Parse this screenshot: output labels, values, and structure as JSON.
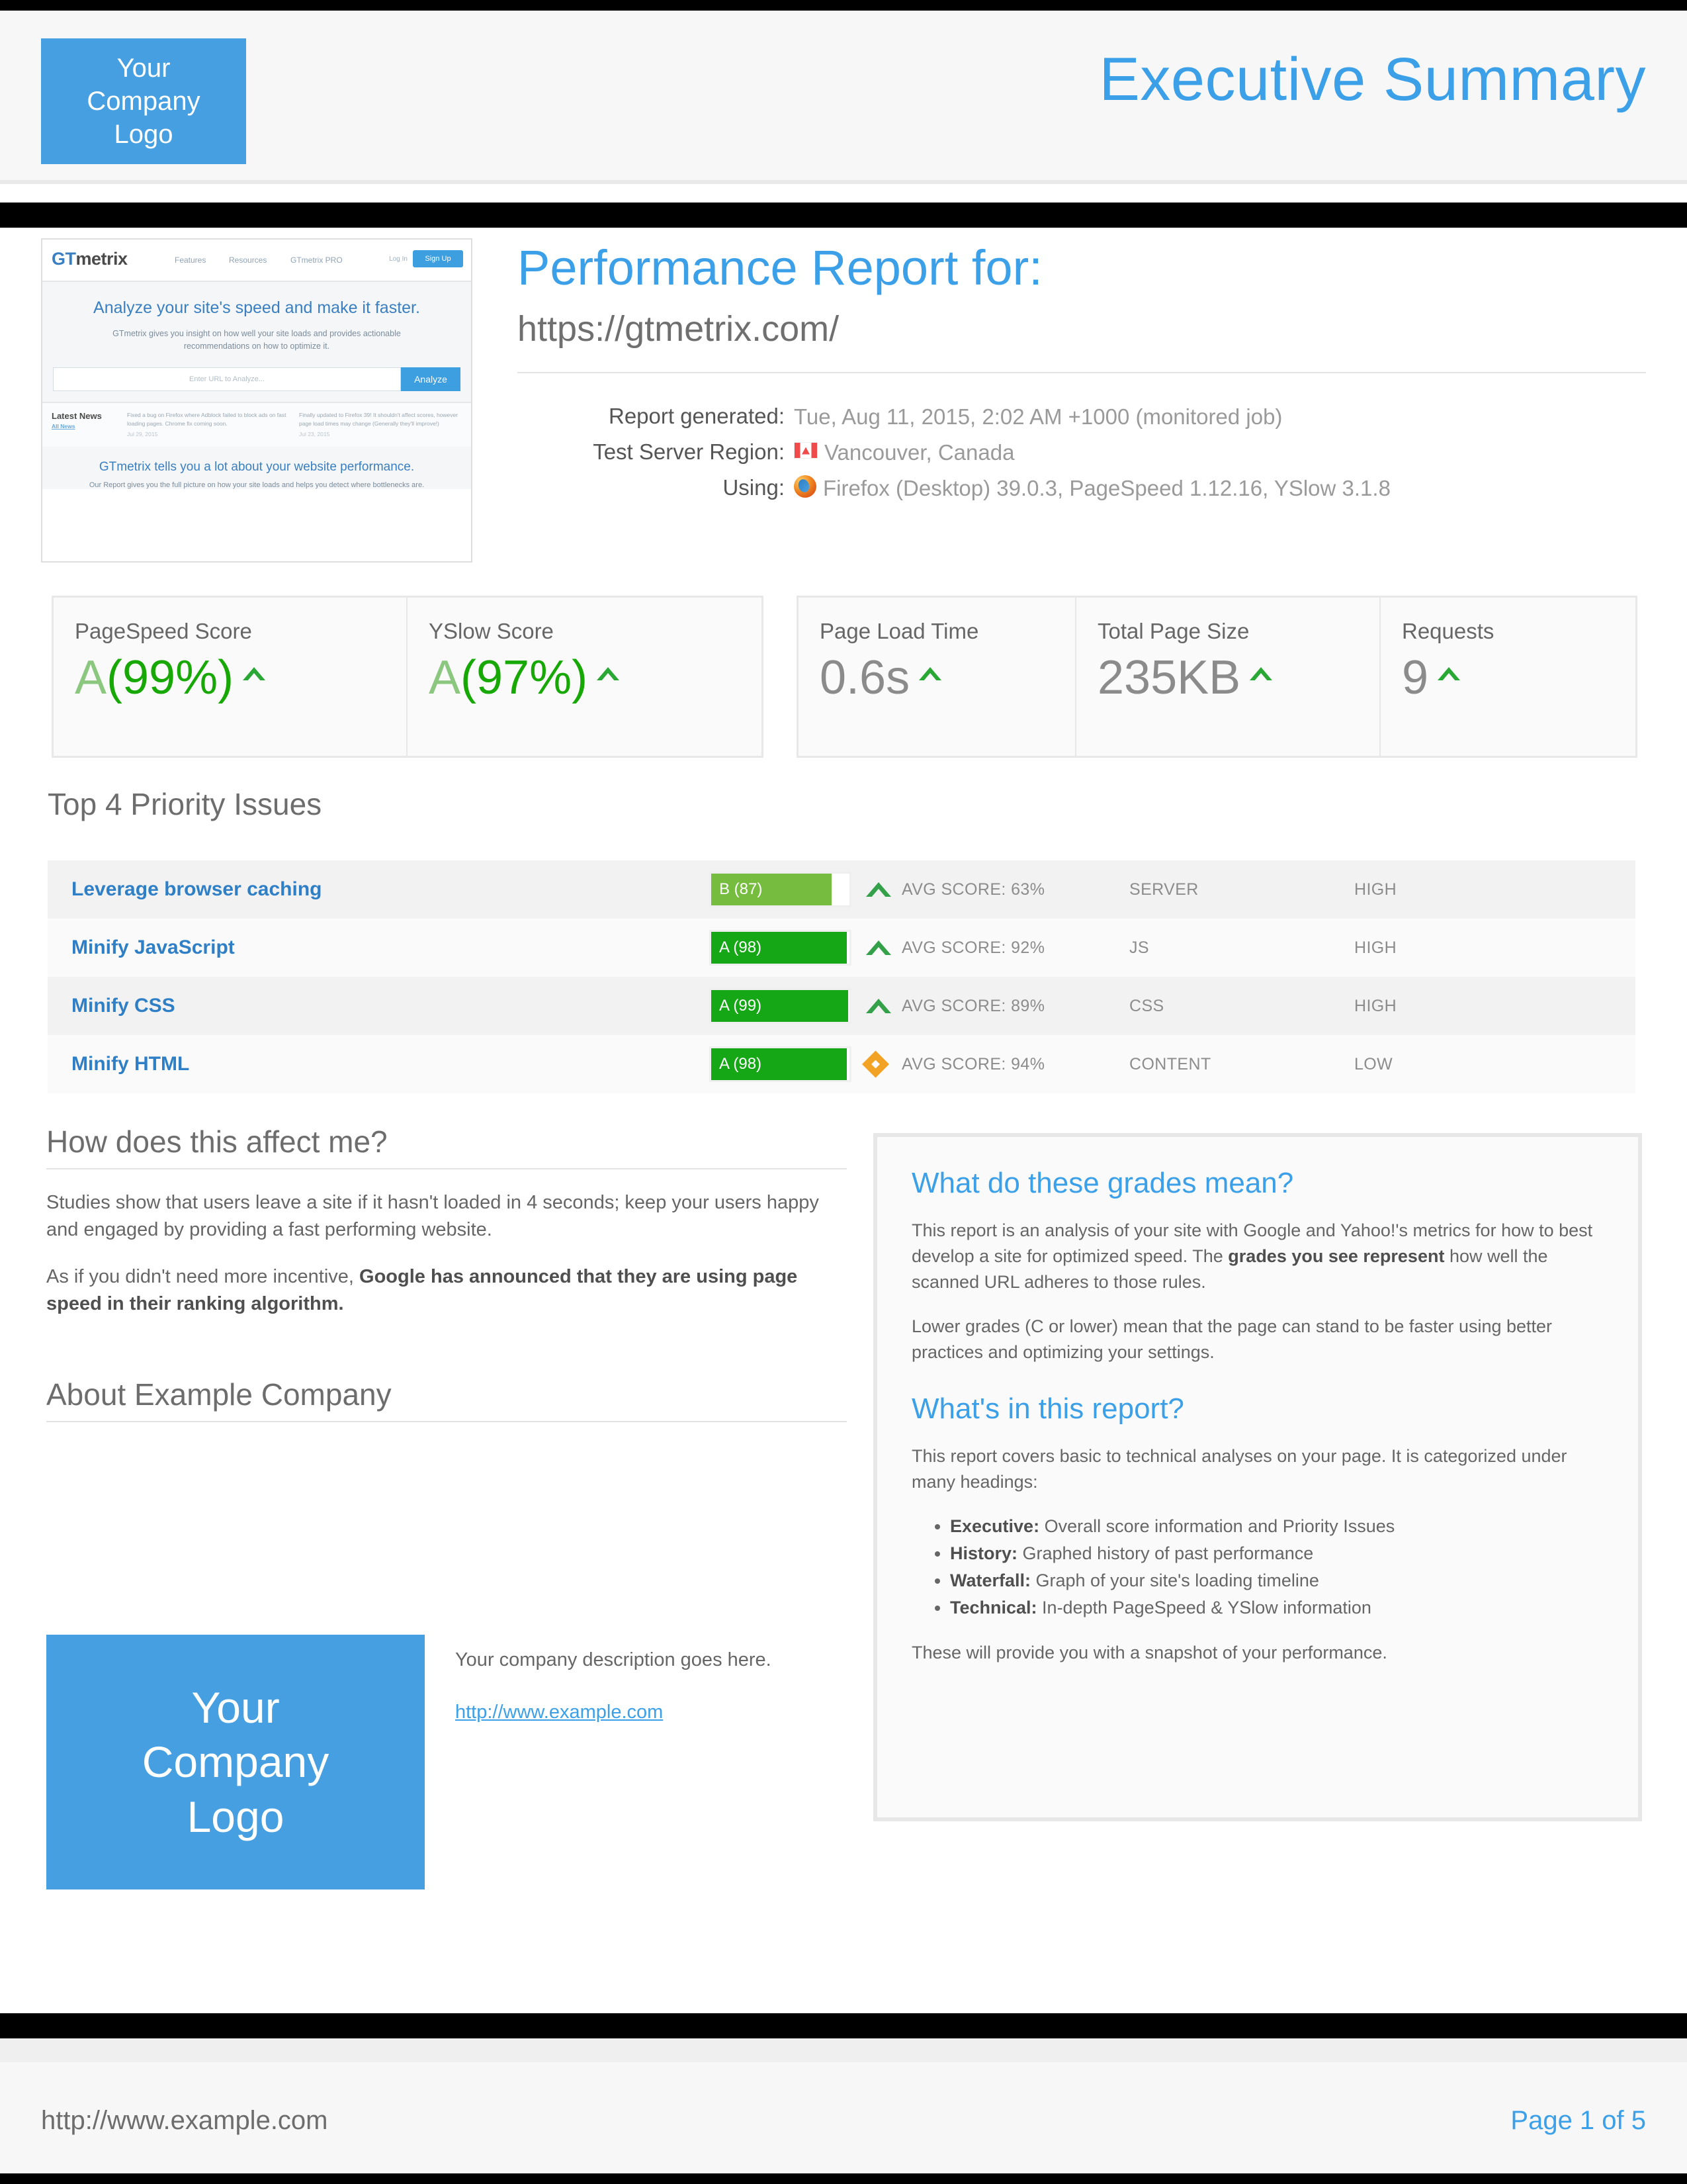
{
  "header": {
    "logo_text": "Your\nCompany\nLogo",
    "title": "Executive Summary"
  },
  "thumbnail": {
    "brand": "GTmetrix",
    "nav": [
      "Features",
      "Resources",
      "GTmetrix PRO"
    ],
    "login": "Log In",
    "signup": "Sign Up",
    "hero_heading": "Analyze your site's speed and make it faster.",
    "hero_sub": "GTmetrix gives you insight on how well your site loads and provides actionable recommendations on how to optimize it.",
    "input_placeholder": "Enter URL to Analyze...",
    "analyze_button": "Analyze",
    "news_title": "Latest News",
    "news_link": "All News",
    "news_1": "Fixed a bug on Firefox where Adblock failed to block ads on fast loading pages. Chrome fix coming soon.",
    "news_1_date": "Jul 29, 2015",
    "news_2": "Finally updated to Firefox 39! It shouldn't affect scores, however page load times may change (Generally they'll improve!)",
    "news_2_date": "Jul 23, 2015",
    "footer_heading": "GTmetrix tells you a lot about your website performance.",
    "footer_sub": "Our Report gives you the full picture on how your site loads and helps you detect where bottlenecks are."
  },
  "report": {
    "title": "Performance Report for:",
    "url": "https://gtmetrix.com/",
    "meta": [
      {
        "label": "Report generated:",
        "value": "Tue, Aug 11, 2015, 2:02 AM +1000 (monitored job)",
        "icon": "none"
      },
      {
        "label": "Test Server Region:",
        "value": "Vancouver, Canada",
        "icon": "canada-flag-icon"
      },
      {
        "label": "Using:",
        "value": "Firefox (Desktop) 39.0.3, PageSpeed 1.12.16, YSlow 3.1.8",
        "icon": "firefox-icon"
      }
    ]
  },
  "scores": {
    "grade_boxes": [
      {
        "label": "PageSpeed Score",
        "grade": "A",
        "percent": "(99%)",
        "trend": "up"
      },
      {
        "label": "YSlow Score",
        "grade": "A",
        "percent": "(97%)",
        "trend": "up"
      }
    ],
    "metric_boxes": [
      {
        "label": "Page Load Time",
        "value": "0.6s",
        "trend": "up"
      },
      {
        "label": "Total Page Size",
        "value": "235KB",
        "trend": "up"
      },
      {
        "label": "Requests",
        "value": "9",
        "trend": "up"
      }
    ]
  },
  "priority": {
    "heading": "Top 4 Priority Issues",
    "rows": [
      {
        "name": "Leverage browser caching",
        "grade": "B (87)",
        "score": 87,
        "bar_color": "#76bc3f",
        "avg": "AVG SCORE: 63%",
        "marker": "up-arrow",
        "type": "SERVER",
        "priority": "HIGH"
      },
      {
        "name": "Minify JavaScript",
        "grade": "A (98)",
        "score": 98,
        "bar_color": "#16a716",
        "avg": "AVG SCORE: 92%",
        "marker": "up-arrow",
        "type": "JS",
        "priority": "HIGH"
      },
      {
        "name": "Minify CSS",
        "grade": "A (99)",
        "score": 99,
        "bar_color": "#16a716",
        "avg": "AVG SCORE: 89%",
        "marker": "up-arrow",
        "type": "CSS",
        "priority": "HIGH"
      },
      {
        "name": "Minify HTML",
        "grade": "A (98)",
        "score": 98,
        "bar_color": "#16a716",
        "avg": "AVG SCORE: 94%",
        "marker": "diamond",
        "type": "CONTENT",
        "priority": "LOW"
      }
    ]
  },
  "affect": {
    "heading": "How does this affect me?",
    "p1": "Studies show that users leave a site if it hasn't loaded in 4 seconds; keep your users happy and engaged by providing a fast performing website.",
    "p2_plain": "As if you didn't need more incentive, ",
    "p2_bold": "Google has announced that they are using page speed in their ranking algorithm."
  },
  "about": {
    "heading": "About Example Company",
    "logo_text": "Your\nCompany\nLogo",
    "description": "Your company description goes here.",
    "link": "http://www.example.com"
  },
  "grades_panel": {
    "heading": "What do these grades mean?",
    "p1_a": "This report is an analysis of your site with Google and Yahoo!'s metrics for how to best develop a site for optimized speed. The ",
    "p1_b": "grades you see represent",
    "p1_c": " how well the scanned URL adheres to those rules.",
    "p2": "Lower grades (C or lower) mean that the page can stand to be faster using better practices and optimizing your settings.",
    "heading2": "What's in this report?",
    "p3": "This report covers basic to technical analyses on your page. It is categorized under many headings:",
    "items": [
      {
        "term": "Executive:",
        "desc": " Overall score information and Priority Issues"
      },
      {
        "term": "History:",
        "desc": " Graphed history of past performance"
      },
      {
        "term": "Waterfall:",
        "desc": " Graph of your site's loading timeline"
      },
      {
        "term": "Technical:",
        "desc": " In-depth PageSpeed & YSlow information"
      }
    ],
    "p4": "These will provide you with a snapshot of your performance."
  },
  "footer": {
    "url": "http://www.example.com",
    "page": "Page 1 of 5"
  },
  "colors": {
    "brand_blue": "#3ca0e8",
    "logo_blue": "#469fe0",
    "grade_green": "#17a806",
    "grade_light_green": "#8cc77f",
    "bar_a_green": "#16a716",
    "bar_b_green": "#76bc3f",
    "diamond_orange": "#f2a325",
    "arrow_green": "#35a04a"
  }
}
